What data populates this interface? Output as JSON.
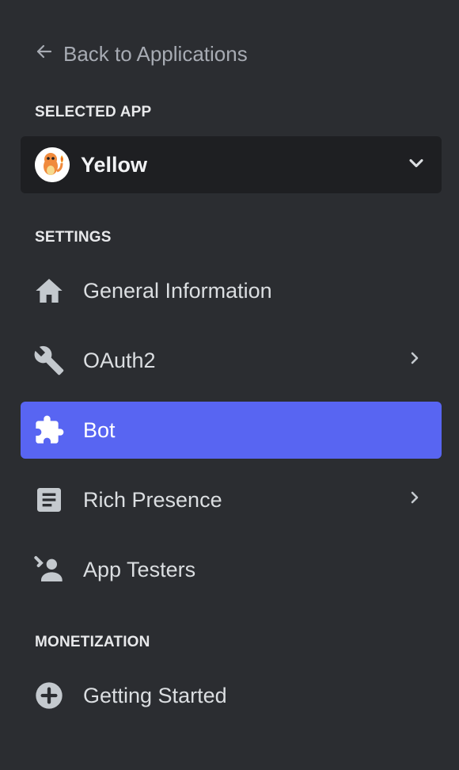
{
  "back_link": {
    "label": "Back to Applications"
  },
  "selected_app": {
    "section_title": "SELECTED APP",
    "name": "Yellow"
  },
  "settings": {
    "section_title": "SETTINGS",
    "items": [
      {
        "label": "General Information",
        "icon": "home-icon",
        "has_chevron": false,
        "active": false
      },
      {
        "label": "OAuth2",
        "icon": "wrench-icon",
        "has_chevron": true,
        "active": false
      },
      {
        "label": "Bot",
        "icon": "puzzle-piece-icon",
        "has_chevron": false,
        "active": true
      },
      {
        "label": "Rich Presence",
        "icon": "document-icon",
        "has_chevron": true,
        "active": false
      },
      {
        "label": "App Testers",
        "icon": "user-icon",
        "has_chevron": false,
        "active": false
      }
    ]
  },
  "monetization": {
    "section_title": "MONETIZATION",
    "items": [
      {
        "label": "Getting Started",
        "icon": "plus-circle-icon",
        "has_chevron": false,
        "active": false
      }
    ]
  },
  "colors": {
    "background": "#2b2d31",
    "select_background": "#1e1f22",
    "active_accent": "#5865f2",
    "text_muted": "#a7abb3",
    "text_primary": "#dbdee1"
  }
}
